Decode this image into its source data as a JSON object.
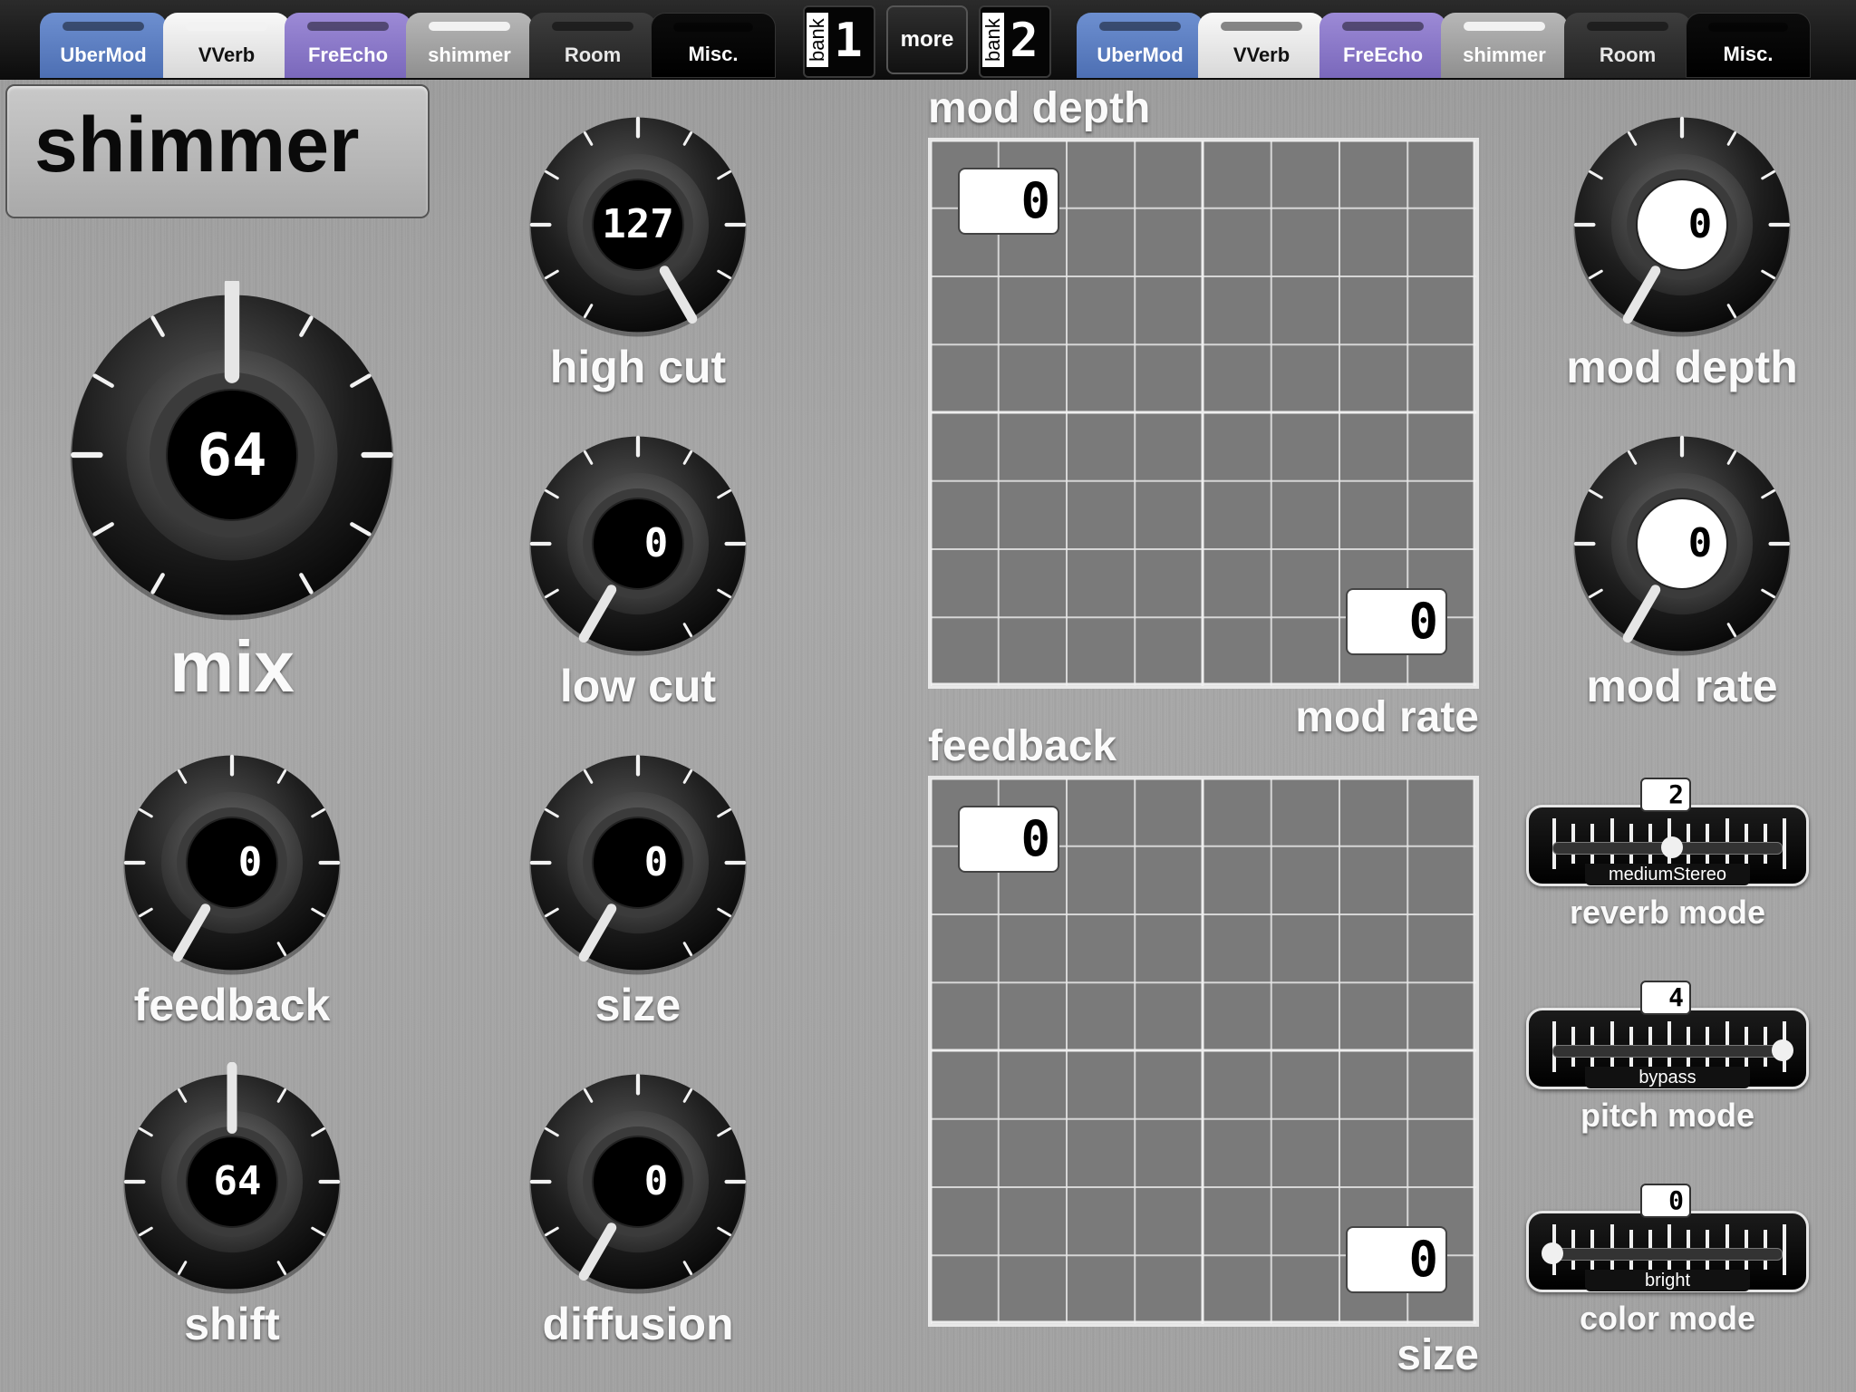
{
  "colors": {
    "ubermod": "#5c7fc3",
    "vverb": "#eeeeee",
    "freecho": "#8b79c9",
    "shimmer": "#a9a9a9",
    "room": "#2c2c2c",
    "misc": "#050505"
  },
  "tabs_left": [
    {
      "label": "UberMod",
      "icon": "blue-tab"
    },
    {
      "label": "VVerb",
      "icon": "white-tab"
    },
    {
      "label": "FreEcho",
      "icon": "purple-tab"
    },
    {
      "label": "shimmer",
      "icon": "gray-tab"
    },
    {
      "label": "Room",
      "icon": "dark-tab"
    },
    {
      "label": "Misc.",
      "icon": "black-tab"
    }
  ],
  "tabs_right": [
    {
      "label": "UberMod"
    },
    {
      "label": "VVerb"
    },
    {
      "label": "FreEcho"
    },
    {
      "label": "shimmer"
    },
    {
      "label": "Room"
    },
    {
      "label": "Misc."
    }
  ],
  "bank1": {
    "word": "bank",
    "number": "1"
  },
  "bank2": {
    "word": "bank",
    "number": "2"
  },
  "more_label": "more",
  "preset_title": "shimmer",
  "knobs": {
    "mix": {
      "label": "mix",
      "value": "64"
    },
    "high_cut": {
      "label": "high cut",
      "value": "127"
    },
    "low_cut": {
      "label": "low cut",
      "value": "0"
    },
    "feedback": {
      "label": "feedback",
      "value": "0"
    },
    "size": {
      "label": "size",
      "value": "0"
    },
    "shift": {
      "label": "shift",
      "value": "64"
    },
    "diffusion": {
      "label": "diffusion",
      "value": "0"
    },
    "mod_depth": {
      "label": "mod depth",
      "value": "0"
    },
    "mod_rate": {
      "label": "mod rate",
      "value": "0"
    }
  },
  "pads": {
    "top": {
      "y_label": "mod depth",
      "x_label": "mod rate",
      "y_value": "0",
      "x_value": "0"
    },
    "bottom": {
      "y_label": "feedback",
      "x_label": "size",
      "y_value": "0",
      "x_value": "0"
    }
  },
  "sliders": {
    "reverb_mode": {
      "label": "reverb mode",
      "value": "2",
      "mode": "mediumStereo",
      "level": 0.52
    },
    "pitch_mode": {
      "label": "pitch mode",
      "value": "4",
      "mode": "bypass",
      "level": 1.0
    },
    "color_mode": {
      "label": "color mode",
      "value": "0",
      "mode": "bright",
      "level": 0.0
    }
  }
}
